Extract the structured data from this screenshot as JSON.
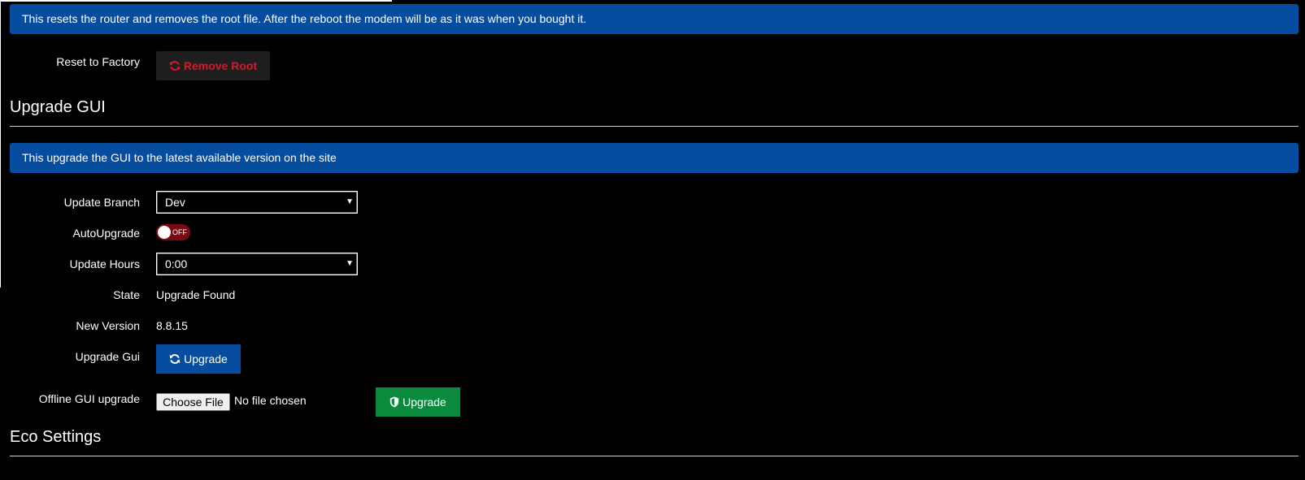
{
  "reset": {
    "info": "This resets the router and removes the root file. After the reboot the modem will be as it was when you bought it.",
    "label": "Reset to Factory",
    "button_label": "Remove Root",
    "button_icon": "refresh-icon",
    "button_color": "#e0142b"
  },
  "upgrade_gui": {
    "title": "Upgrade GUI",
    "info": "This upgrade the GUI to the latest available version on the site",
    "update_branch": {
      "label": "Update Branch",
      "value": "Dev"
    },
    "auto_upgrade": {
      "label": "AutoUpgrade",
      "state": "OFF"
    },
    "update_hours": {
      "label": "Update Hours",
      "value": "0:00"
    },
    "state": {
      "label": "State",
      "value": "Upgrade Found"
    },
    "new_version": {
      "label": "New Version",
      "value": "8.8.15"
    },
    "upgrade_gui_row": {
      "label": "Upgrade Gui",
      "button_label": "Upgrade",
      "button_icon": "refresh-icon"
    },
    "offline": {
      "label": "Offline GUI upgrade",
      "choose_file_label": "Choose File",
      "no_file_text": "No file chosen",
      "button_label": "Upgrade",
      "button_icon": "shield-icon"
    }
  },
  "eco": {
    "title": "Eco Settings"
  },
  "colors": {
    "info_bg": "#064c9f",
    "upgrade_button": "#064c9f",
    "offline_upgrade_button": "#0a8a3c",
    "toggle_off": "#7a0a12"
  }
}
